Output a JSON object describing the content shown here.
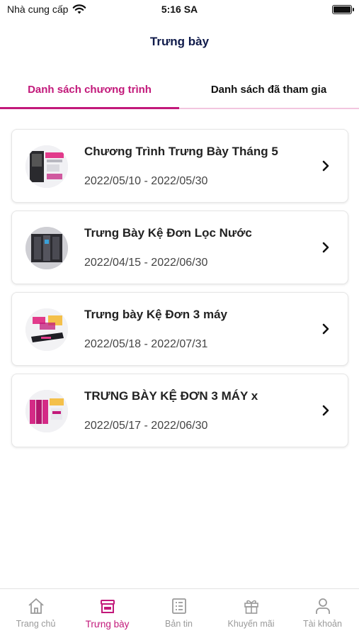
{
  "status_bar": {
    "carrier": "Nhà cung cấp",
    "time": "5:16 SA",
    "wifi_icon": "wifi-icon",
    "battery_level": 1.0
  },
  "header": {
    "title": "Trưng bày"
  },
  "tabs": [
    {
      "label": "Danh sách chương trình",
      "active": true
    },
    {
      "label": "Danh sách đã tham gia",
      "active": false
    }
  ],
  "programs": [
    {
      "title": "Chương Trình Trưng Bày Tháng 5",
      "date_range": "2022/05/10 - 2022/05/30",
      "thumbnail": "promo-poster-thumbnail"
    },
    {
      "title": "Trưng Bày Kệ Đơn Lọc Nước",
      "date_range": "2022/04/15 - 2022/06/30",
      "thumbnail": "water-purifier-thumbnail"
    },
    {
      "title": "Trưng bày Kệ Đơn 3 máy",
      "date_range": "2022/05/18 - 2022/07/31",
      "thumbnail": "shelf-display-thumbnail"
    },
    {
      "title": "TRƯNG BÀY KỆ ĐƠN 3 MÁY x",
      "date_range": "2022/05/17 - 2022/06/30",
      "thumbnail": "pink-shelf-thumbnail"
    }
  ],
  "bottom_nav": [
    {
      "label": "Trang chủ",
      "icon": "home-icon",
      "active": false
    },
    {
      "label": "Trưng bày",
      "icon": "store-icon",
      "active": true
    },
    {
      "label": "Bản tin",
      "icon": "newsletter-icon",
      "active": false
    },
    {
      "label": "Khuyến mãi",
      "icon": "gift-icon",
      "active": false
    },
    {
      "label": "Tài khoản",
      "icon": "user-icon",
      "active": false
    }
  ],
  "colors": {
    "accent": "#c2187a",
    "title_dark": "#0f1a4a",
    "inactive_nav": "#9a9a9a"
  }
}
